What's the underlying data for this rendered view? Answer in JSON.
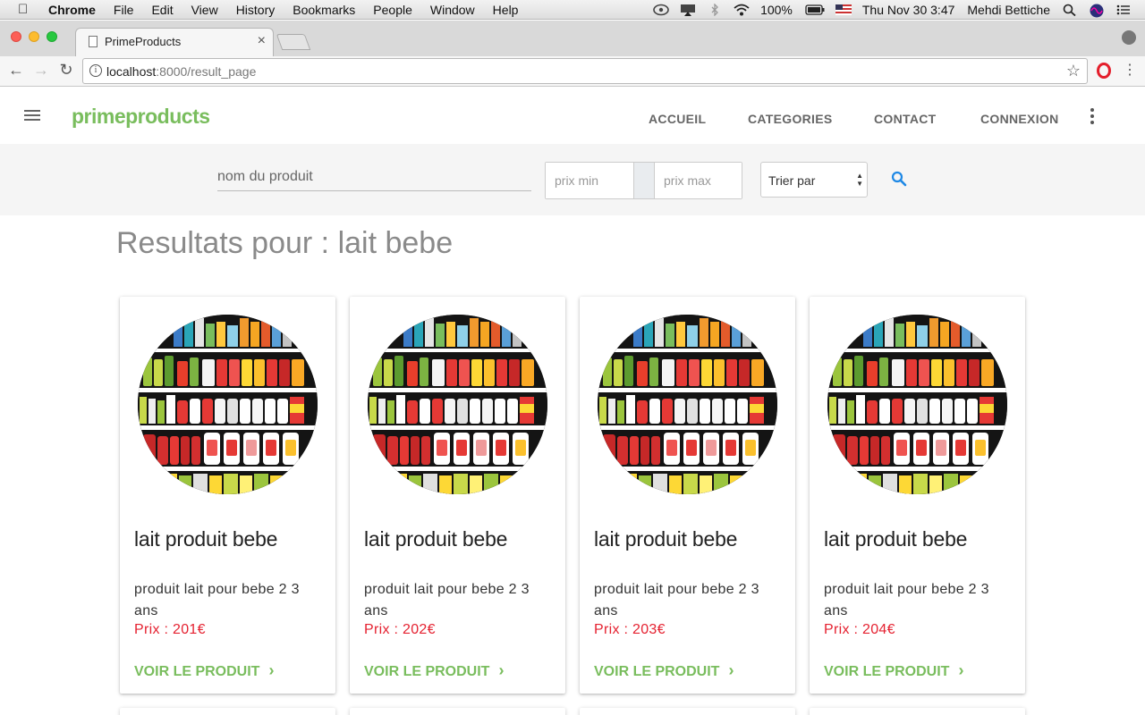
{
  "os_menubar": {
    "app_name": "Chrome",
    "menus": [
      "File",
      "Edit",
      "View",
      "History",
      "Bookmarks",
      "People",
      "Window",
      "Help"
    ],
    "battery": "100%",
    "datetime": "Thu Nov 30  3:47",
    "user": "Mehdi Bettiche"
  },
  "browser": {
    "tab_title": "PrimeProducts",
    "url_host": "localhost",
    "url_rest": ":8000/result_page"
  },
  "navbar": {
    "brand": "primeproducts",
    "links": [
      "ACCUEIL",
      "CATEGORIES",
      "CONTACT",
      "CONNEXION"
    ]
  },
  "search": {
    "name_placeholder": "nom du produit",
    "price_min_placeholder": "prix min",
    "price_max_placeholder": "prix max",
    "sort_label": "Trier par"
  },
  "results": {
    "title": "Resultats pour : lait bebe",
    "cards": [
      {
        "title": "lait produit bebe",
        "desc": "produit lait pour bebe 2 3 ans",
        "price": "Prix : 201€",
        "link": "VOIR LE PRODUIT"
      },
      {
        "title": "lait produit bebe",
        "desc": "produit lait pour bebe 2 3 ans",
        "price": "Prix : 202€",
        "link": "VOIR LE PRODUIT"
      },
      {
        "title": "lait produit bebe",
        "desc": "produit lait pour bebe 2 3 ans",
        "price": "Prix : 203€",
        "link": "VOIR LE PRODUIT"
      },
      {
        "title": "lait produit bebe",
        "desc": "produit lait pour bebe 2 3 ans",
        "price": "Prix : 204€",
        "link": "VOIR LE PRODUIT"
      }
    ]
  },
  "colors": {
    "brand_green": "#79bd5d",
    "price_red": "#e52231",
    "search_blue": "#1e88e5"
  },
  "icons": [
    "apple-icon",
    "hamburger-icon",
    "more-vert-icon",
    "search-icon",
    "chevron-right-icon",
    "star-icon",
    "info-icon",
    "back-icon",
    "forward-icon",
    "reload-icon"
  ]
}
